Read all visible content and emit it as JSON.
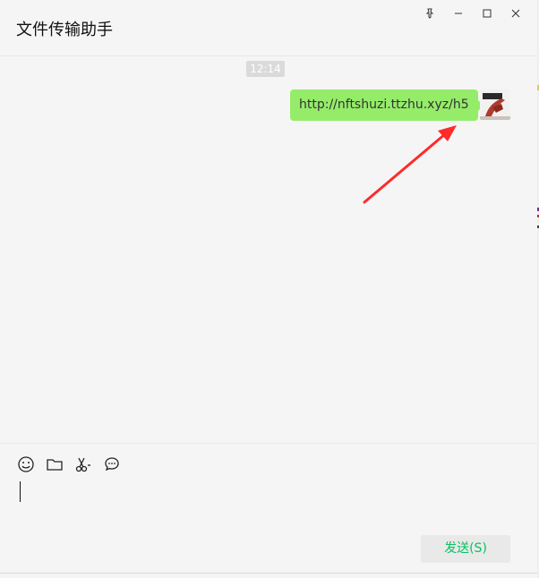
{
  "window": {
    "title": "文件传输助手"
  },
  "chat": {
    "timestamp": "12:14",
    "messages": [
      {
        "text": "http://nftshuzi.ttzhu.xyz/h5"
      }
    ]
  },
  "input": {
    "send_label": "发送(S)"
  },
  "colors": {
    "bubble": "#95ec69",
    "send_text": "#07c160",
    "arrow": "#ff2a2a"
  },
  "icons": [
    "pin-icon",
    "minimize-icon",
    "maximize-icon",
    "close-icon",
    "emoji-icon",
    "folder-icon",
    "scissors-icon",
    "chat-bubble-icon"
  ]
}
